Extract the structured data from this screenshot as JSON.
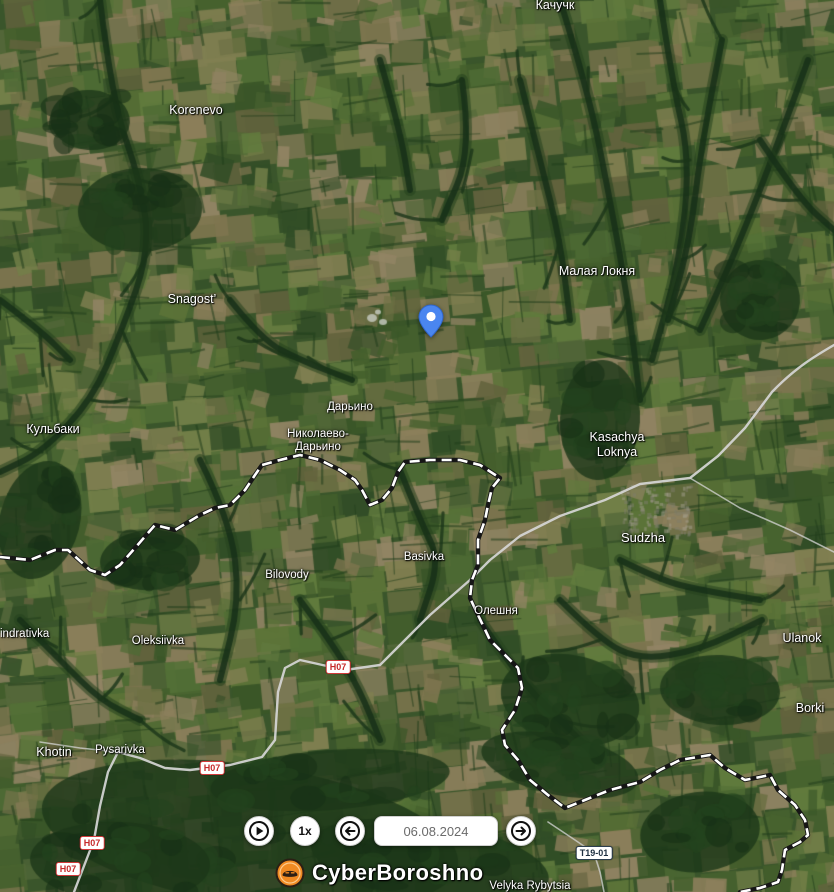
{
  "map": {
    "labels": {
      "kachuchk": "Качучк",
      "korenevo": "Korenevo",
      "malaya_loknya": "Малая Локня",
      "snagost": "Snagost’",
      "daryino": "Дарьино",
      "kulbaki": "Кульбаки",
      "nikolaevo_daryino": {
        "line1": "Николаево-",
        "line2": "Дарьино"
      },
      "kasachya_loknya": {
        "line1": "Kasachya",
        "line2": "Loknya"
      },
      "sudzha": "Sudzha",
      "basivka": "Basivka",
      "bilovody": "Bilovody",
      "oleshnya": "Олешня",
      "ulanok": "Ulanok",
      "kindrativka": "indrativka",
      "oleksiivka": "Oleksiivka",
      "borki": "Borki",
      "khotin": "Khotin",
      "pysarivka": "Pysarivka",
      "velyka_rybytsia": "Velyka Rybytsia"
    },
    "roads": [
      {
        "label": "H07"
      },
      {
        "label": "H07"
      },
      {
        "label": "H07"
      },
      {
        "label": "H07"
      },
      {
        "label": "T19-01"
      }
    ],
    "pin_icon": "map-pin-icon"
  },
  "controls": {
    "play_icon": "play-icon",
    "speed": "1x",
    "prev_icon": "arrow-left-icon",
    "date": "06.08.2024",
    "next_icon": "arrow-right-icon"
  },
  "branding": {
    "name": "CyberBoroshno",
    "icon": "logo-icon"
  },
  "colors": {
    "pin": "#4a86f0",
    "road": "#d6d6d6",
    "border_base": "#161616",
    "border_dash": "#ffffff",
    "route_badge": "#c62a2a",
    "brand_accent": "#ef8a22",
    "button_bg": "#ffffff",
    "label_text": "#ffffff"
  }
}
